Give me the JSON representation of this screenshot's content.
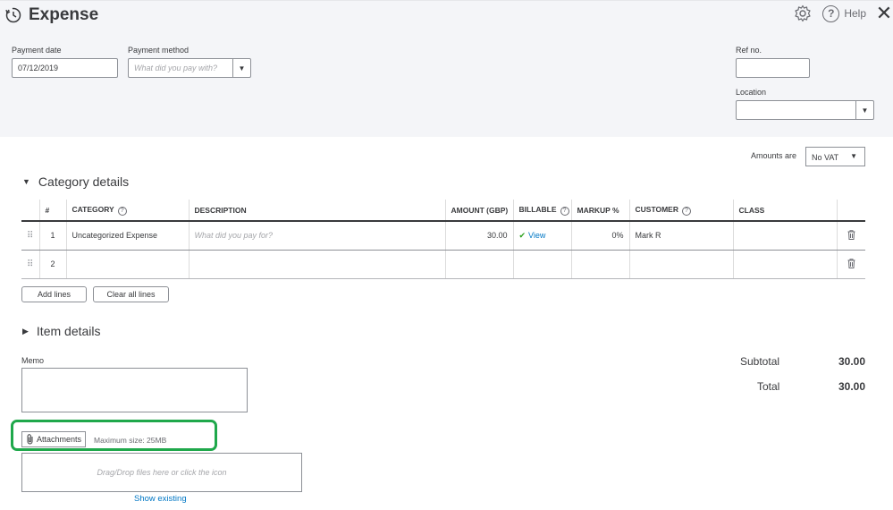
{
  "header": {
    "title": "Expense",
    "help_label": "Help"
  },
  "form": {
    "payment_date": {
      "label": "Payment date",
      "value": "07/12/2019"
    },
    "payment_method": {
      "label": "Payment method",
      "placeholder": "What did you pay with?"
    },
    "ref_no": {
      "label": "Ref no.",
      "value": ""
    },
    "location": {
      "label": "Location",
      "value": ""
    },
    "amounts_are": {
      "label": "Amounts are",
      "value": "No VAT"
    }
  },
  "category_details": {
    "title": "Category details",
    "columns": [
      "#",
      "CATEGORY",
      "DESCRIPTION",
      "AMOUNT (GBP)",
      "BILLABLE",
      "MARKUP %",
      "CUSTOMER",
      "CLASS"
    ],
    "rows": [
      {
        "num": "1",
        "category": "Uncategorized Expense",
        "description_placeholder": "What did you pay for?",
        "amount": "30.00",
        "billable": "View",
        "markup": "0%",
        "customer": "Mark R",
        "class": ""
      },
      {
        "num": "2",
        "category": "",
        "description_placeholder": "",
        "amount": "",
        "billable": "",
        "markup": "",
        "customer": "",
        "class": ""
      }
    ],
    "add_lines": "Add lines",
    "clear_all_lines": "Clear all lines"
  },
  "item_details": {
    "title": "Item details"
  },
  "memo": {
    "label": "Memo",
    "value": ""
  },
  "totals": {
    "subtotal_label": "Subtotal",
    "subtotal": "30.00",
    "total_label": "Total",
    "total": "30.00"
  },
  "attachments": {
    "button": "Attachments",
    "max_size": "Maximum size: 25MB",
    "dropzone": "Drag/Drop files here or click the icon",
    "show_existing": "Show existing"
  },
  "colors": {
    "link": "#0077c5",
    "highlight": "#1fa84b",
    "check": "#2ca01c",
    "header_bg": "#f4f5f8"
  }
}
